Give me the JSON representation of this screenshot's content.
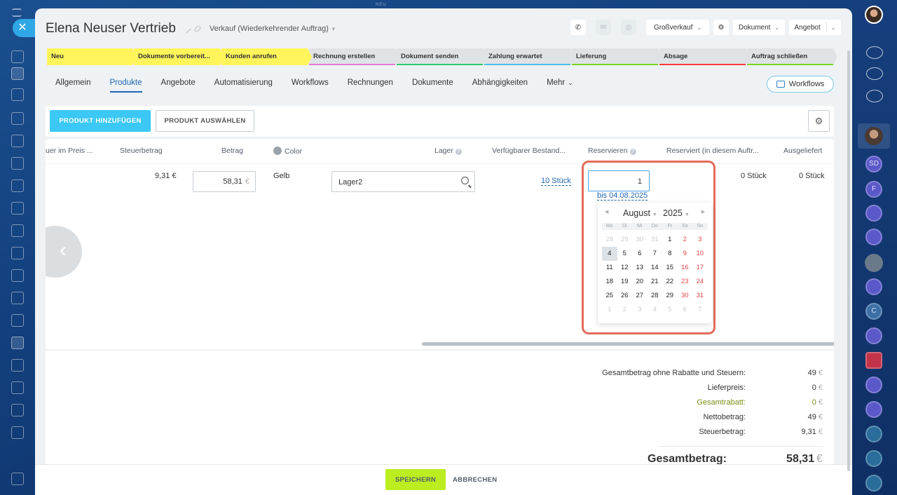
{
  "top_label": "NEU",
  "header": {
    "title": "Elena Neuser Vertrieb",
    "pipeline": "Verkauf (Wiederkehrender Auftrag)",
    "tools": {
      "category": "Großverkauf",
      "document": "Dokument",
      "offer": "Angebot"
    }
  },
  "stages": [
    {
      "label": "Neu",
      "width": 122,
      "active": true,
      "bar": "#fff55a"
    },
    {
      "label": "Dokumente vorbereit...",
      "width": 123,
      "active": true,
      "bar": "#fff55a"
    },
    {
      "label": "Kunden anrufen",
      "width": 123,
      "active": true,
      "bar": "#fff55a"
    },
    {
      "label": "Rechnung erstellen",
      "width": 123,
      "active": false,
      "bar": "#e57bd2"
    },
    {
      "label": "Dokument senden",
      "width": 123,
      "active": false,
      "bar": "#2ecc71"
    },
    {
      "label": "Zahlung erwartet",
      "width": 123,
      "active": false,
      "bar": "#47c1e6"
    },
    {
      "label": "Lieferung",
      "width": 123,
      "active": false,
      "bar": "#7ed321"
    },
    {
      "label": "Absage",
      "width": 123,
      "active": false,
      "bar": "#ff3b3b"
    },
    {
      "label": "Auftrag schließen",
      "width": 123,
      "active": false,
      "bar": "#7ed321"
    }
  ],
  "tabs": [
    "Allgemein",
    "Produkte",
    "Angebote",
    "Automatisierung",
    "Workflows",
    "Rechnungen",
    "Dokumente",
    "Abhängigkeiten",
    "Mehr"
  ],
  "active_tab": "Produkte",
  "workflows_button": "Workflows",
  "toolbar": {
    "add_product": "PRODUKT HINZUFÜGEN",
    "select_product": "PRODUKT AUSWÄHLEN"
  },
  "columns": {
    "tax_in_price": "uer im Preis ...",
    "tax_amount": "Steuerbetrag",
    "amount": "Betrag",
    "color": "Color",
    "store": "Lager",
    "available": "Verfügbarer Bestand...",
    "reserve": "Reservieren",
    "reserved": "Reserviert (in diesem Auftr...",
    "delivered": "Ausgeliefert"
  },
  "row": {
    "tax_amount": "9,31 €",
    "amount": "58,31",
    "amount_currency": "€",
    "color": "Gelb",
    "store": "Lager2",
    "available": "10 Stück",
    "reserve_qty": "1",
    "reserve_until": "bis 04.08.2025",
    "reserved": "0 Stück",
    "delivered": "0 Stück"
  },
  "calendar": {
    "month": "August",
    "year": "2025",
    "day_names": [
      "Mo",
      "Di",
      "Mi",
      "Do",
      "Fr",
      "Sa",
      "So"
    ],
    "weeks": [
      [
        "28",
        "29",
        "30",
        "31",
        "1",
        "2",
        "3"
      ],
      [
        "4",
        "5",
        "6",
        "7",
        "8",
        "9",
        "10"
      ],
      [
        "11",
        "12",
        "13",
        "14",
        "15",
        "16",
        "17"
      ],
      [
        "18",
        "19",
        "20",
        "21",
        "22",
        "23",
        "24"
      ],
      [
        "25",
        "26",
        "27",
        "28",
        "29",
        "30",
        "31"
      ],
      [
        "1",
        "2",
        "3",
        "4",
        "5",
        "6",
        "7"
      ]
    ],
    "selected": "4"
  },
  "totals": {
    "net_without_discounts_label": "Gesamtbetrag ohne Rabatte und Steuern:",
    "net_without_discounts": "49",
    "delivery_label": "Lieferpreis:",
    "delivery": "0",
    "discount_label": "Gesamtrabatt:",
    "discount": "0",
    "net_label": "Nettobetrag:",
    "net": "49",
    "tax_label": "Steuerbetrag:",
    "tax": "9,31",
    "total_label": "Gesamtbetrag:",
    "total": "58,31",
    "currency": "€"
  },
  "footer": {
    "save": "SPEICHERN",
    "cancel": "ABBRECHEN"
  },
  "right_rail_badges": [
    "SD",
    "F",
    "C"
  ]
}
